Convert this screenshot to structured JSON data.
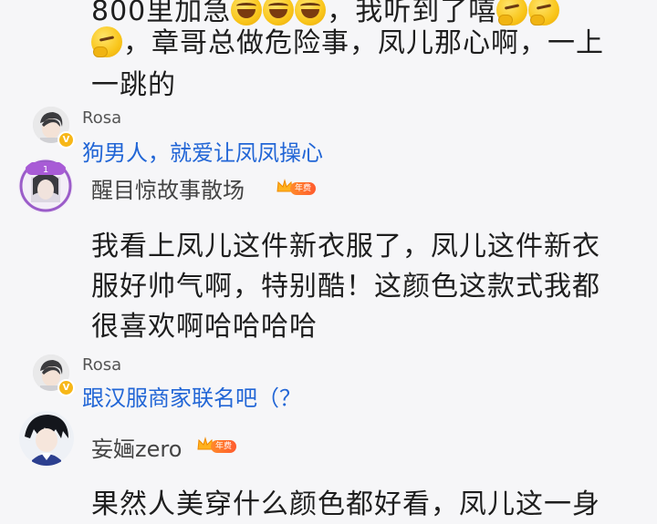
{
  "post_text": {
    "line1_prefix": "800里加急",
    "line1_suffix": "，我听到了嘻",
    "line2": "，章哥总做危险事，凤儿那心啊，一上",
    "line3": "一跳的"
  },
  "emoji_icons": [
    "laugh-cry-emoji",
    "laugh-cry-emoji",
    "laugh-cry-emoji",
    "thinking-emoji",
    "thinking-emoji",
    "thinking-emoji"
  ],
  "reply1": {
    "name": "Rosa",
    "text": "狗男人，就爱让凤凤操心"
  },
  "comment1": {
    "name": "醒目惊故事散场",
    "badge": "年费",
    "avatar_label": "1",
    "lines": [
      "我看上凤儿这件新衣服了，凤儿这件新衣",
      "服好帅气啊，特别酷！这颜色这款式我都",
      "很喜欢啊哈哈哈哈"
    ]
  },
  "reply2": {
    "name": "Rosa",
    "text": "跟汉服商家联名吧（？"
  },
  "comment2": {
    "name": "妄婳zero",
    "badge": "年费",
    "lines": [
      "果然人美穿什么颜色都好看，凤儿这一身"
    ]
  },
  "colors": {
    "link_blue": "#2266d6",
    "badge_orange": "#ff6a2c",
    "background": "#f6f6f8"
  }
}
